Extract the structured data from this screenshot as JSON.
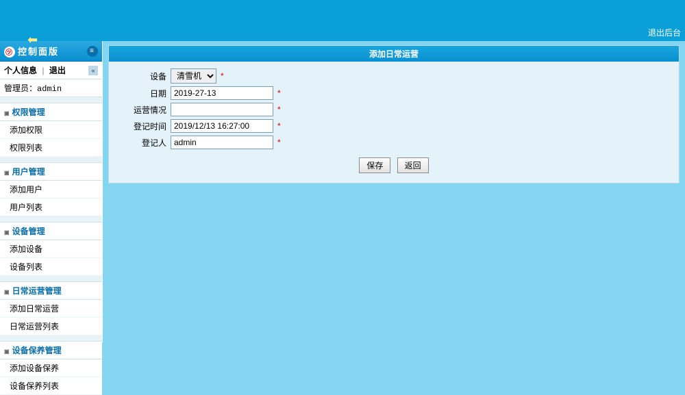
{
  "topbar": {
    "logout": "退出后台"
  },
  "panel": {
    "title": "控制面版",
    "profile": "个人信息",
    "exit": "退出",
    "admin_label": "管理员：",
    "admin_name": "admin"
  },
  "nav": [
    {
      "title": "权限管理",
      "items": [
        "添加权限",
        "权限列表"
      ]
    },
    {
      "title": "用户管理",
      "items": [
        "添加用户",
        "用户列表"
      ]
    },
    {
      "title": "设备管理",
      "items": [
        "添加设备",
        "设备列表"
      ]
    },
    {
      "title": "日常运营管理",
      "items": [
        "添加日常运营",
        "日常运营列表"
      ]
    },
    {
      "title": "设备保养管理",
      "items": [
        "添加设备保养",
        "设备保养列表"
      ]
    }
  ],
  "form": {
    "title": "添加日常运营",
    "device_label": "设备",
    "device_value": "清雪机",
    "date_label": "日期",
    "date_value": "2019-27-13",
    "status_label": "运营情况",
    "status_value": "",
    "regtime_label": "登记时间",
    "regtime_value": "2019/12/13 16:27:00",
    "regby_label": "登记人",
    "regby_value": "admin",
    "save": "保存",
    "back": "返回"
  }
}
